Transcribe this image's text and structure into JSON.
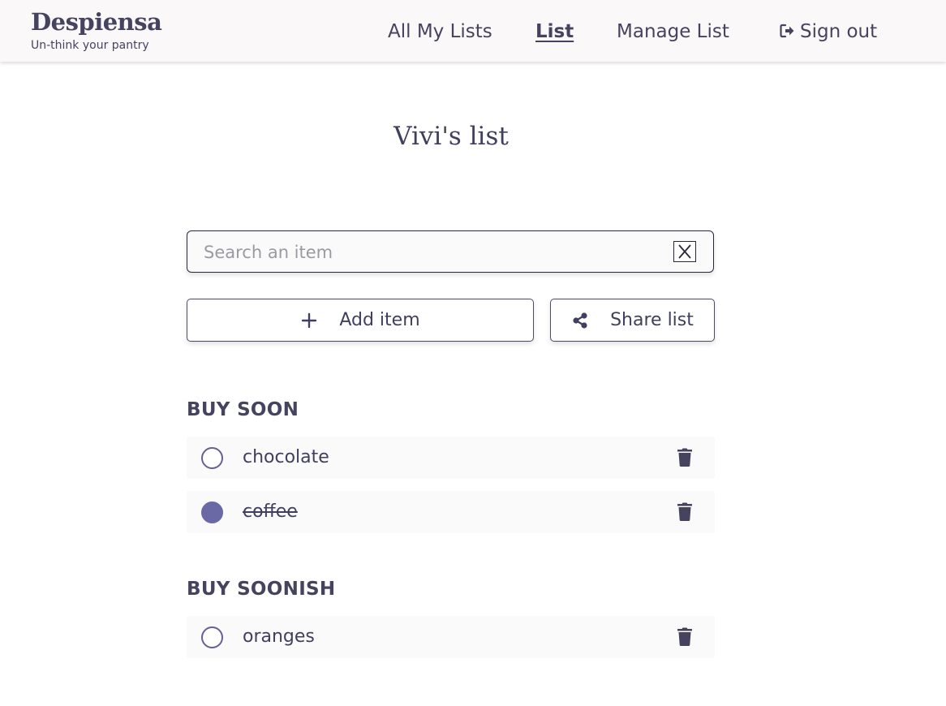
{
  "brand": {
    "name": "Despiensa",
    "tagline": "Un-think your pantry"
  },
  "nav": {
    "all_lists": "All My Lists",
    "list": "List",
    "manage_list": "Manage List",
    "sign_out": "Sign out",
    "sign_out_icon": "sign-out-icon",
    "active": "List"
  },
  "page": {
    "title": "Vivi's list"
  },
  "search": {
    "placeholder": "Search an item",
    "value": "",
    "clear_icon": "close-box-icon"
  },
  "actions": {
    "add_item": {
      "label": "Add item",
      "icon": "plus-icon"
    },
    "share_list": {
      "label": "Share list",
      "icon": "share-icon"
    }
  },
  "sections": [
    {
      "heading": "BUY SOON",
      "items": [
        {
          "name": "chocolate",
          "checked": false
        },
        {
          "name": "coffee",
          "checked": true
        }
      ]
    },
    {
      "heading": "BUY SOONISH",
      "items": [
        {
          "name": "oranges",
          "checked": false
        }
      ]
    }
  ],
  "colors": {
    "text": "#413f5e",
    "accent": "#6a69a5",
    "header_bg": "#fbf8f9",
    "item_bg": "#fafafa"
  }
}
